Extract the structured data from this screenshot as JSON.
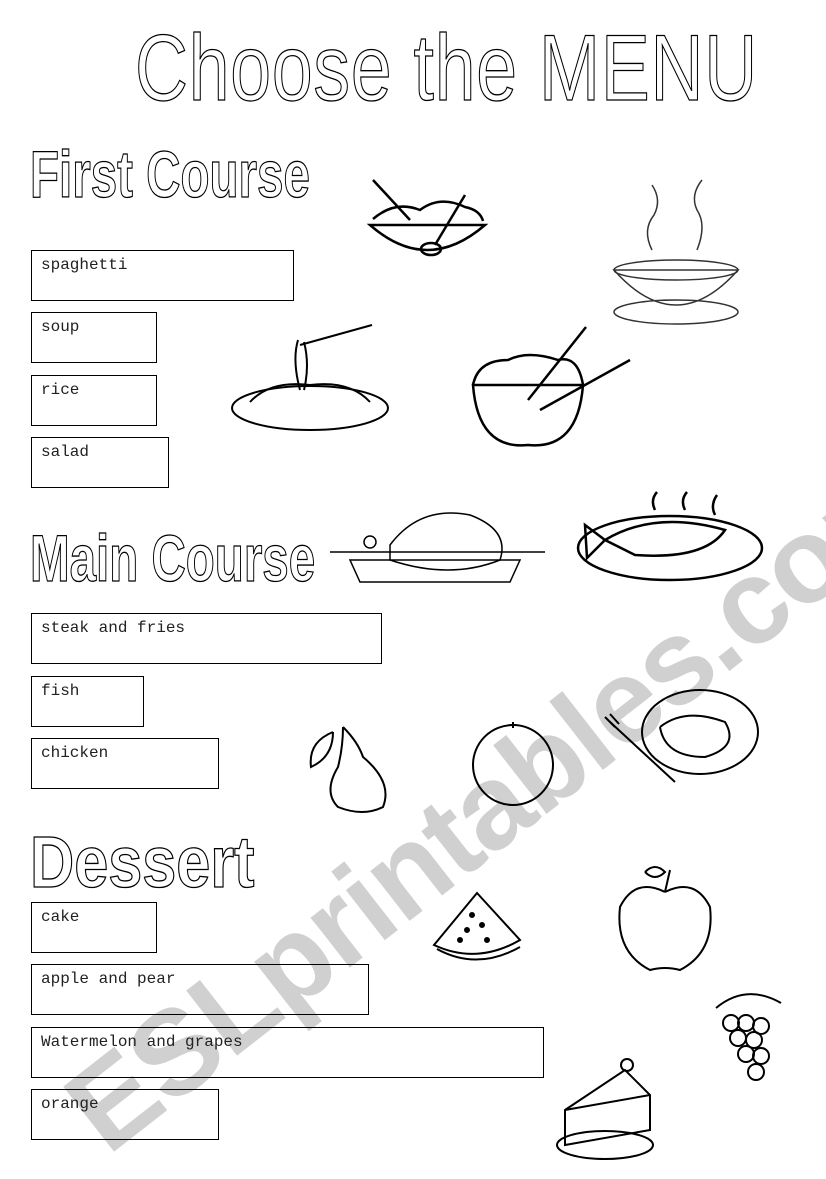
{
  "title": "Choose the MENU",
  "watermark": "ESLprintables.com",
  "sections": [
    {
      "heading": "First Course",
      "items": [
        "spaghetti",
        "soup",
        "rice",
        "salad"
      ]
    },
    {
      "heading": "Main Course",
      "items": [
        "steak and fries",
        "fish",
        "chicken"
      ]
    },
    {
      "heading": "Dessert",
      "items": [
        "cake",
        "apple and pear",
        "Watermelon and grapes",
        "orange"
      ]
    }
  ],
  "illustrations": [
    "salad",
    "soup",
    "spaghetti",
    "rice",
    "roast chicken",
    "fish",
    "pear",
    "orange",
    "steak and fries",
    "watermelon",
    "apple",
    "grapes",
    "cake"
  ]
}
